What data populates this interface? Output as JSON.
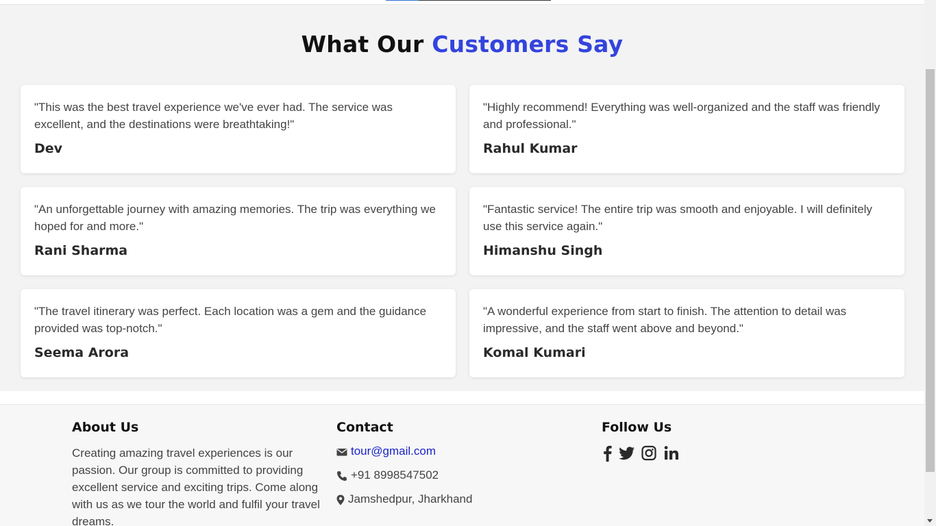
{
  "section": {
    "title_prefix": "What Our ",
    "title_accent": "Customers Say",
    "accent_color": "#3344dd"
  },
  "testimonials": [
    {
      "quote": "\"This was the best travel experience we've ever had. The service was excellent, and the destinations were breathtaking!\"",
      "author": "Dev"
    },
    {
      "quote": "\"Highly recommend! Everything was well-organized and the staff was friendly and professional.\"",
      "author": "Rahul Kumar"
    },
    {
      "quote": "\"An unforgettable journey with amazing memories. The trip was everything we hoped for and more.\"",
      "author": "Rani Sharma"
    },
    {
      "quote": "\"Fantastic service! The entire trip was smooth and enjoyable. I will definitely use this service again.\"",
      "author": "Himanshu Singh"
    },
    {
      "quote": "\"The travel itinerary was perfect. Each location was a gem and the guidance provided was top-notch.\"",
      "author": "Seema Arora"
    },
    {
      "quote": "\"A wonderful experience from start to finish. The attention to detail was impressive, and the staff went above and beyond.\"",
      "author": "Komal Kumari"
    }
  ],
  "footer": {
    "about": {
      "heading": "About Us",
      "text": "Creating amazing travel experiences is our passion. Our group is committed to providing excellent service and exciting trips. Come along with us as we tour the world and fulfil your travel dreams."
    },
    "contact": {
      "heading": "Contact",
      "email": "tour@gmail.com",
      "phone": "+91 8998547502",
      "location": "Jamshedpur, Jharkhand",
      "icons": [
        "envelope-icon",
        "phone-icon",
        "map-marker-icon"
      ]
    },
    "follow": {
      "heading": "Follow Us",
      "icons": [
        "facebook-icon",
        "twitter-icon",
        "instagram-icon",
        "linkedin-icon"
      ]
    }
  }
}
